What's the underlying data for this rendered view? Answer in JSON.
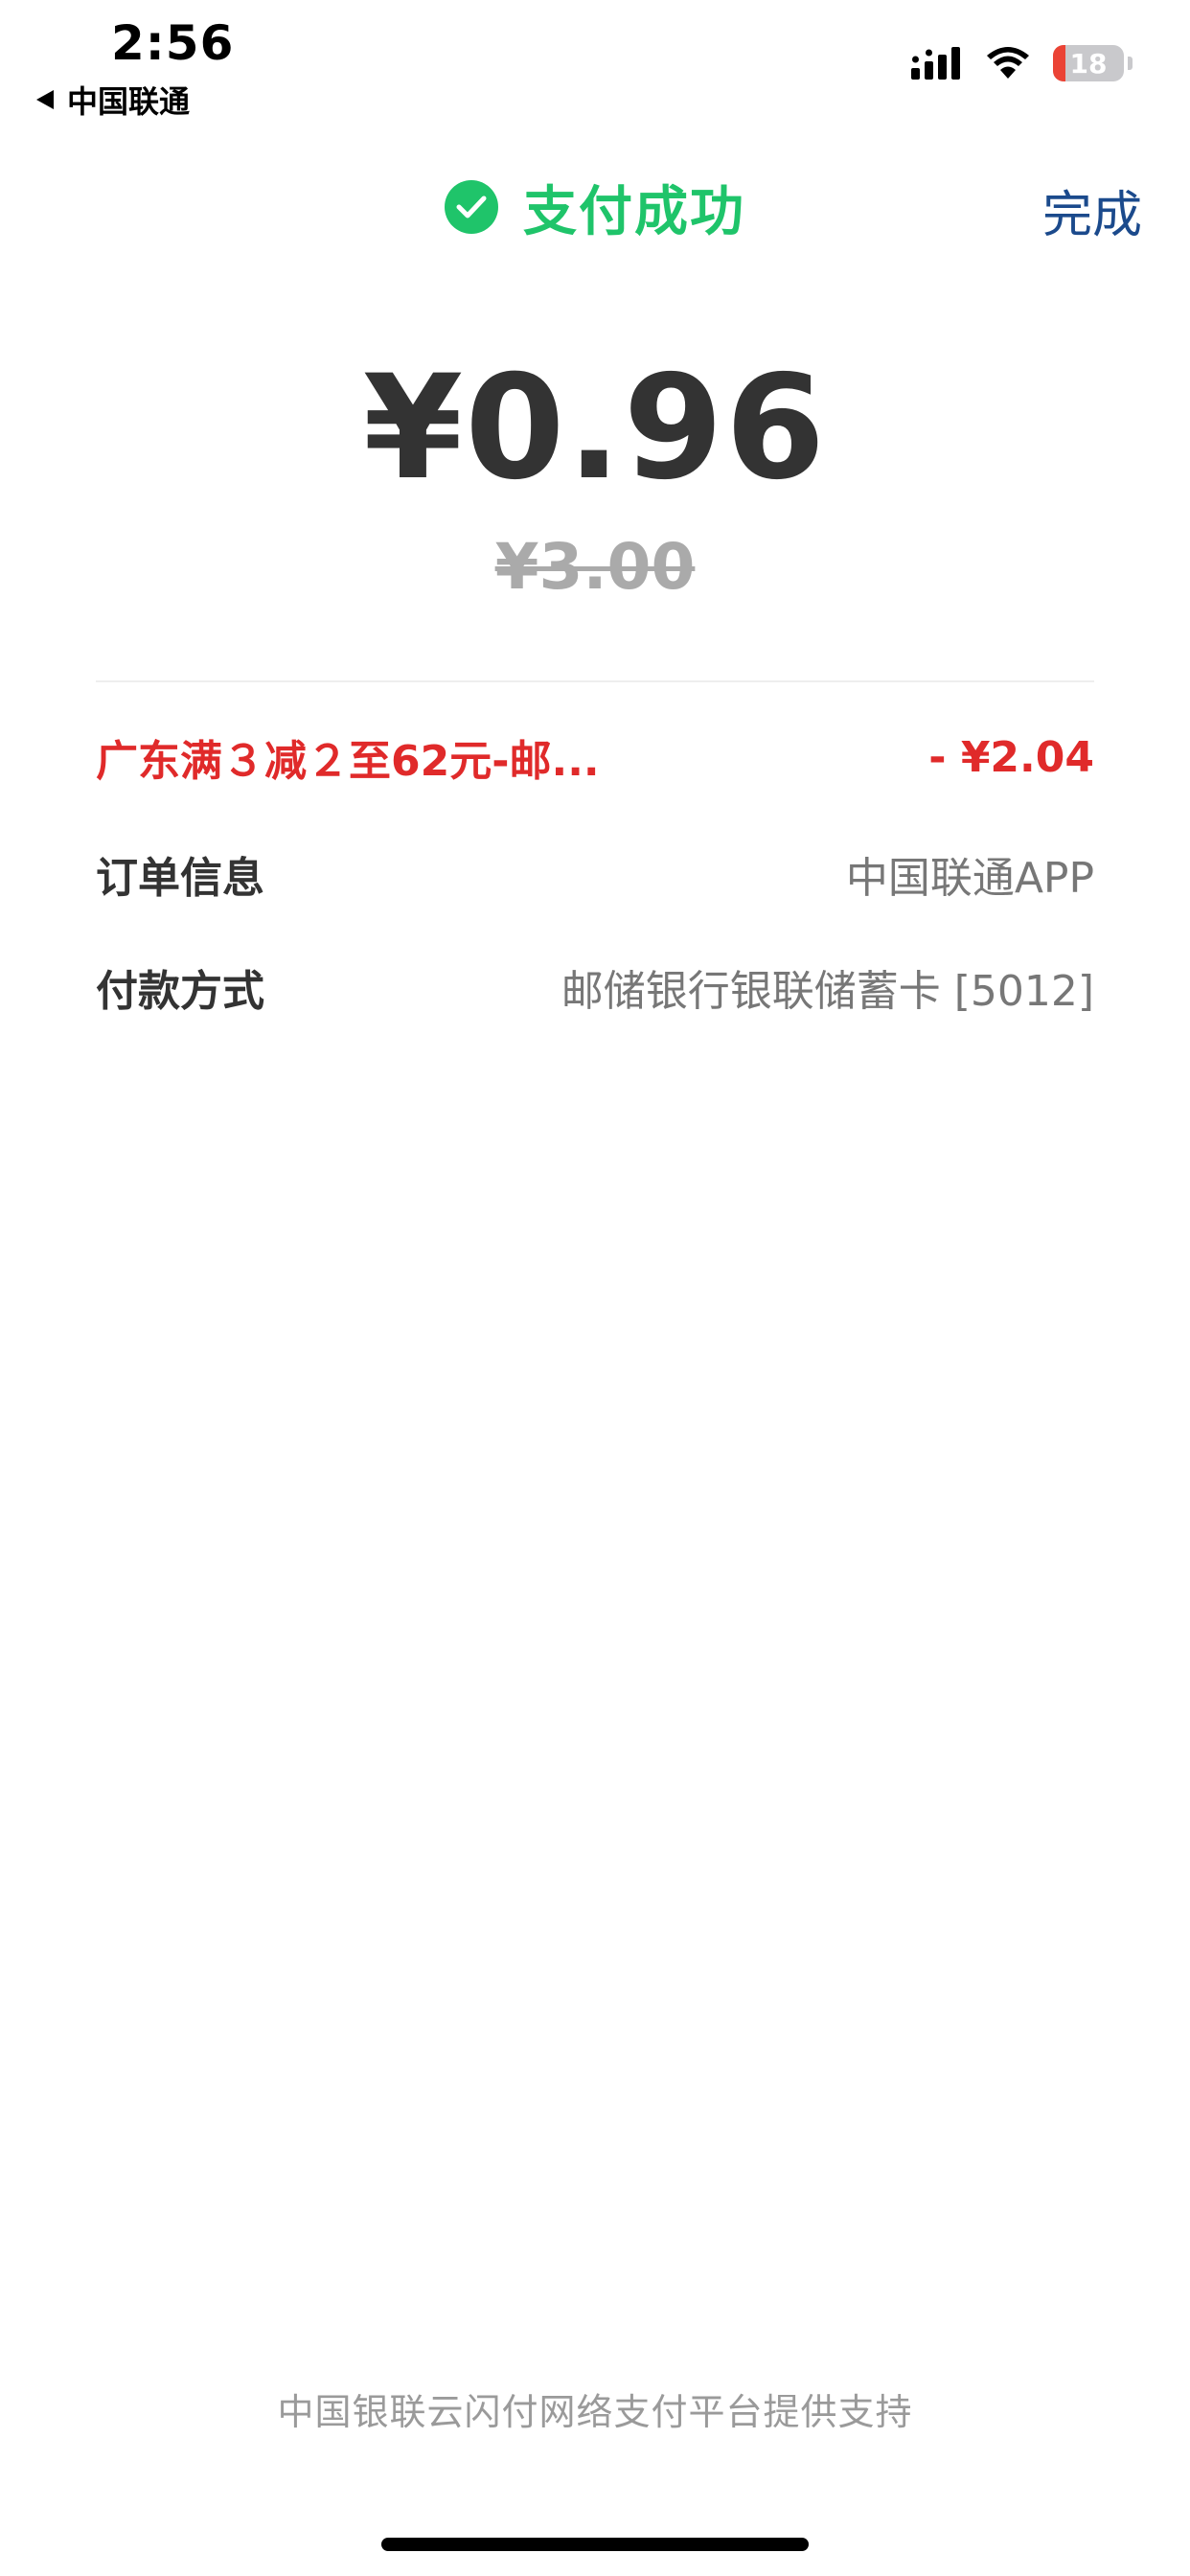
{
  "status_bar": {
    "time": "2:56",
    "back_carrier": "中国联通",
    "battery_level": "18",
    "battery_fraction": 0.18,
    "signal_icon": "cellular-signal-icon",
    "wifi_icon": "wifi-icon"
  },
  "header": {
    "title": "支付成功",
    "done_label": "完成",
    "success_icon": "check-circle-icon"
  },
  "amount": {
    "paid": "¥0.96",
    "original": "¥3.00"
  },
  "details": {
    "discount_label": "广东满３减２至62元-邮...",
    "discount_value": "- ¥2.04",
    "order_label": "订单信息",
    "order_value": "中国联通APP",
    "method_label": "付款方式",
    "method_value": "邮储银行银联储蓄卡 [5012]"
  },
  "footer": {
    "support_text": "中国银联云闪付网络支付平台提供支持"
  },
  "colors": {
    "success_green": "#1fc46a",
    "done_blue": "#1b4a8c",
    "discount_red": "#e02a2a",
    "battery_red": "#eb4335"
  }
}
